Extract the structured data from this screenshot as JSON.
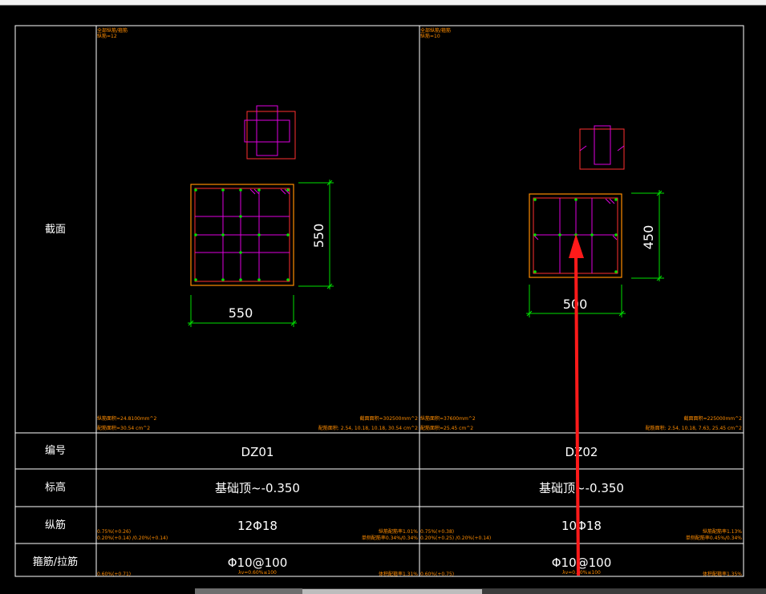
{
  "table": {
    "row_labels": {
      "section": "截面",
      "id": "编号",
      "elevation": "标高",
      "long_bars": "纵筋",
      "stirrups": "箍筋/拉筋"
    }
  },
  "columns": [
    {
      "note_title": "全部纵筋/箍筋",
      "note_count": "纵筋=12",
      "dim_width": "550",
      "dim_height": "550",
      "area_left": "截面面积=302500mm^2",
      "area_left2": "配筋面积=30.54 cm^2",
      "area_right": "纵筋面积=24.8100mm^2",
      "area_right2": "配筋面积: 2.54, 10.18, 10.18, 30.54 cm^2",
      "id": "DZ01",
      "elevation": "基础顶~-0.350",
      "long_bars": "12Φ18",
      "long_note_left": "0.75%(+0.26)",
      "long_note_left2": "0.20%(+0.14) /0.20%(+0.14)",
      "long_note_right": "纵筋配筋率1.01%",
      "long_note_right2": "单侧配筋率0.34%/0.34%",
      "stirrups": "Φ10@100",
      "stirrup_note": "λv=0.60%≤100",
      "stirrup_note_left": "0.60%(+0.71)",
      "stirrup_note_right": "体积配箍率1.31%"
    },
    {
      "note_title": "全部纵筋/箍筋",
      "note_count": "纵筋=10",
      "dim_width": "500",
      "dim_height": "450",
      "area_left": "截面面积=225000mm^2",
      "area_left2": "配筋面积=25.45 cm^2",
      "area_right": "纵筋面积=37600mm^2",
      "area_right2": "配筋面积: 2.54, 10.18, 7.63, 25.45 cm^2",
      "id": "DZ02",
      "elevation": "基础顶~-0.350",
      "long_bars": "10Φ18",
      "long_note_left": "0.75%(+0.38)",
      "long_note_left2": "0.20%(+0.25) /0.20%(+0.14)",
      "long_note_right": "纵筋配筋率1.13%",
      "long_note_right2": "单侧配筋率0.45%/0.34%",
      "stirrups": "Φ10@100",
      "stirrup_note": "λv=0.60%≤100",
      "stirrup_note_left": "0.60%(+0.75)",
      "stirrup_note_right": "体积配箍率1.35%"
    }
  ],
  "colors": {
    "grid": "#ffffff",
    "outline": "#ff8c00",
    "stirrup": "#ff3030",
    "tie": "#e000e0",
    "dimension": "#00e000",
    "text": "#ffffff",
    "note": "#ff8c00",
    "arrow": "#ff1a1a"
  }
}
